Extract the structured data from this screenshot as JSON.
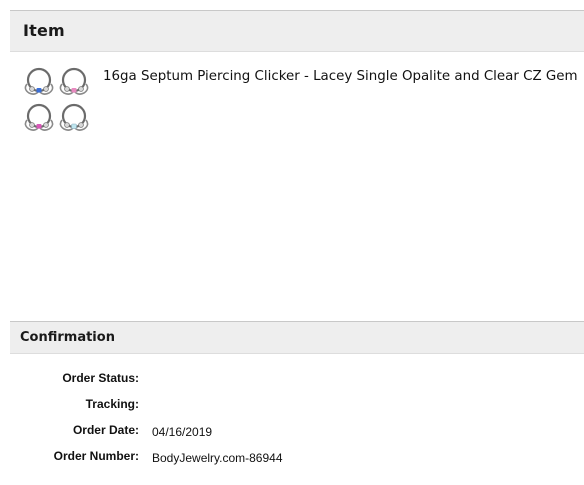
{
  "item_section": {
    "title": "Item"
  },
  "product": {
    "title": "16ga Septum Piercing Clicker - Lacey Single Opalite and Clear CZ Gem",
    "thumbnail_icon": "septum-clicker-variants-icon",
    "gem_colors": [
      "#3a6fd8",
      "#e88ac0",
      "#d957b8",
      "#bfe6ef"
    ]
  },
  "confirmation_section": {
    "title": "Confirmation",
    "rows": [
      {
        "label": "Order Status:",
        "value": ""
      },
      {
        "label": "Tracking:",
        "value": ""
      },
      {
        "label": "Order Date:",
        "value": "04/16/2019"
      },
      {
        "label": "Order Number:",
        "value": "BodyJewelry.com-86944"
      }
    ]
  }
}
